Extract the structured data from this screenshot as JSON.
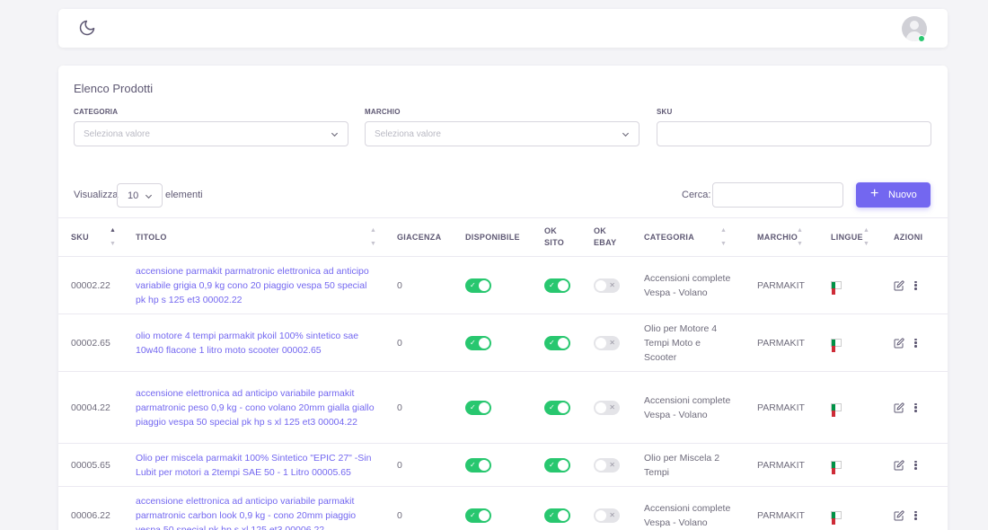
{
  "list": {
    "title": "Elenco Prodotti",
    "filters": [
      {
        "label": "CATEGORIA",
        "placeholder": "Seleziona valore"
      },
      {
        "label": "MARCHIO",
        "placeholder": "Seleziona valore"
      },
      {
        "label": "SKU",
        "placeholder": ""
      }
    ],
    "show_label": "Visualizza",
    "page_length": "10",
    "elements_label": "elementi",
    "search_label": "Cerca:",
    "new_button": "Nuovo"
  },
  "table": {
    "columns": [
      "SKU",
      "TITOLO",
      "GIACENZA",
      "DISPONIBILE",
      "OK SITO",
      "OK EBAY",
      "CATEGORIA",
      "MARCHIO",
      "LINGUE",
      "AZIONI"
    ],
    "rows": [
      {
        "sku": "00002.22",
        "title": "accensione parmakit parmatronic elettronica ad anticipo variabile grigia 0,9 kg cono 20 piaggio vespa 50 special pk hp s 125 et3 00002.22",
        "stock": "0",
        "available": true,
        "ok_site": true,
        "ok_ebay": false,
        "category": "Accensioni complete Vespa - Volano",
        "brand": "PARMAKIT",
        "language": "it"
      },
      {
        "sku": "00002.65",
        "title": "olio motore 4 tempi parmakit pkoil 100% sintetico sae 10w40 flacone 1 litro moto scooter 00002.65",
        "stock": "0",
        "available": true,
        "ok_site": true,
        "ok_ebay": false,
        "category": "Olio per Motore 4 Tempi Moto e Scooter",
        "brand": "PARMAKIT",
        "language": "it"
      },
      {
        "sku": "00004.22",
        "title": "accensione elettronica ad anticipo variabile parmakit parmatronic peso 0,9 kg - cono volano 20mm gialla giallo piaggio vespa 50 special pk hp s xl 125 et3 00004.22",
        "stock": "0",
        "available": true,
        "ok_site": true,
        "ok_ebay": false,
        "category": "Accensioni complete Vespa - Volano",
        "brand": "PARMAKIT",
        "language": "it"
      },
      {
        "sku": "00005.65",
        "title": "Olio per miscela parmakit 100% Sintetico \"EPIC 27\" -Sin Lubit per motori a 2tempi SAE 50 - 1 Litro 00005.65",
        "stock": "0",
        "available": true,
        "ok_site": true,
        "ok_ebay": false,
        "category": "Olio per Miscela 2 Tempi",
        "brand": "PARMAKIT",
        "language": "it"
      },
      {
        "sku": "00006.22",
        "title": "accensione elettronica ad anticipo variabile parmakit parmatronic carbon look 0,9 kg - cono 20mm piaggio vespa 50 special pk hp s xl 125 et3 00006.22",
        "stock": "0",
        "available": true,
        "ok_site": true,
        "ok_ebay": false,
        "category": "Accensioni complete Vespa - Volano",
        "brand": "PARMAKIT",
        "language": "it"
      }
    ]
  },
  "colors": {
    "primary": "#7367f0",
    "success": "#28c76f",
    "toggle_off": "#e4e4e8"
  },
  "icons": [
    "moon-icon",
    "avatar",
    "chevron-down-icon",
    "plus-icon",
    "sort-icon",
    "check-icon",
    "x-icon",
    "italy-flag-icon",
    "edit-icon",
    "more-vertical-icon"
  ]
}
